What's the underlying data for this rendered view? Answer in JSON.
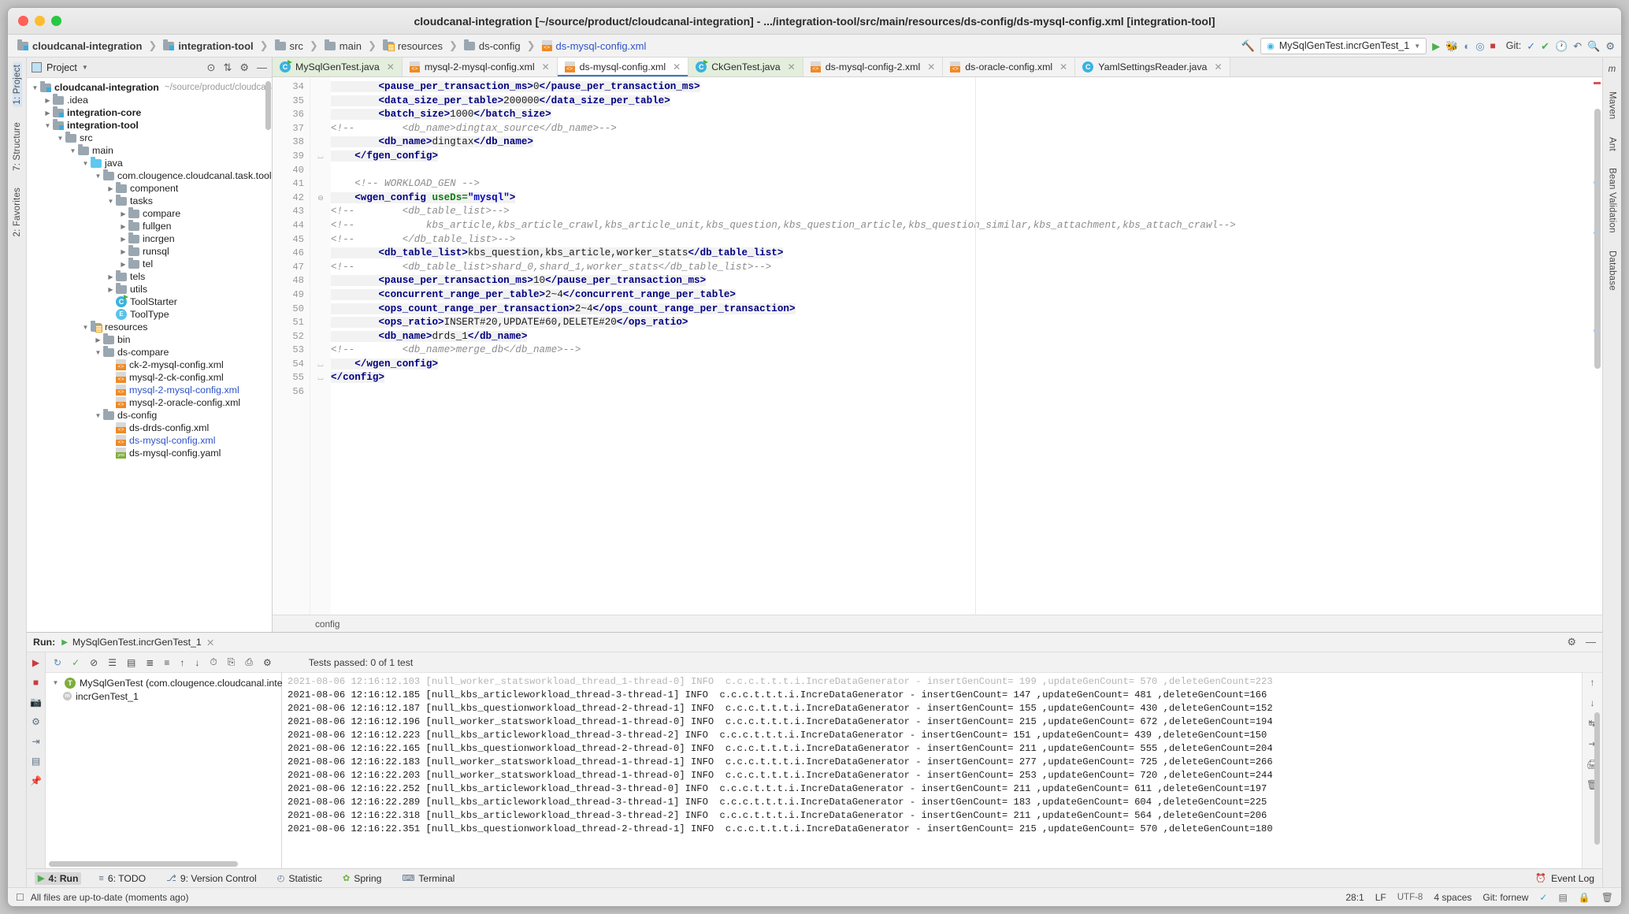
{
  "window": {
    "title": "cloudcanal-integration [~/source/product/cloudcanal-integration] - .../integration-tool/src/main/resources/ds-config/ds-mysql-config.xml [integration-tool]"
  },
  "breadcrumbs": [
    {
      "label": "cloudcanal-integration",
      "icon": "module-folder-icon",
      "style": "bold"
    },
    {
      "label": "integration-tool",
      "icon": "module-folder-icon",
      "style": "bold"
    },
    {
      "label": "src",
      "icon": "folder-icon",
      "style": "normal"
    },
    {
      "label": "main",
      "icon": "folder-icon",
      "style": "normal"
    },
    {
      "label": "resources",
      "icon": "resources-folder-icon",
      "style": "normal"
    },
    {
      "label": "ds-config",
      "icon": "folder-icon",
      "style": "normal"
    },
    {
      "label": "ds-mysql-config.xml",
      "icon": "xml-file-icon",
      "style": "link"
    }
  ],
  "toolbar": {
    "run_configuration": "MySqlGenTest.incrGenTest_1",
    "git_label": "Git:",
    "icons": [
      "hammer-icon",
      "run-icon",
      "debug-icon",
      "coverage-icon",
      "profile-icon",
      "stop-icon",
      "git-update-icon",
      "git-commit-icon",
      "history-icon",
      "undo-icon",
      "search-everywhere-icon",
      "settings-icon"
    ]
  },
  "project_panel": {
    "title": "Project",
    "header_icons": [
      "collapse-icon",
      "expand-icon",
      "settings-icon",
      "hide-icon"
    ],
    "tree": [
      {
        "depth": 0,
        "label": "cloudcanal-integration",
        "hint": "~/source/product/cloudcana",
        "arrow": "open",
        "icon": "module-folder-icon",
        "bold": true
      },
      {
        "depth": 1,
        "label": ".idea",
        "hint": "",
        "arrow": "closed",
        "icon": "folder-icon",
        "bold": false
      },
      {
        "depth": 1,
        "label": "integration-core",
        "hint": "",
        "arrow": "closed",
        "icon": "module-folder-icon",
        "bold": true
      },
      {
        "depth": 1,
        "label": "integration-tool",
        "hint": "",
        "arrow": "open",
        "icon": "module-folder-icon",
        "bold": true
      },
      {
        "depth": 2,
        "label": "src",
        "hint": "",
        "arrow": "open",
        "icon": "folder-icon",
        "bold": false
      },
      {
        "depth": 3,
        "label": "main",
        "hint": "",
        "arrow": "open",
        "icon": "folder-icon",
        "bold": false
      },
      {
        "depth": 4,
        "label": "java",
        "hint": "",
        "arrow": "open",
        "icon": "source-folder-icon",
        "bold": false
      },
      {
        "depth": 5,
        "label": "com.clougence.cloudcanal.task.tools",
        "hint": "",
        "arrow": "open",
        "icon": "package-icon",
        "bold": false
      },
      {
        "depth": 6,
        "label": "component",
        "hint": "",
        "arrow": "closed",
        "icon": "package-icon",
        "bold": false
      },
      {
        "depth": 6,
        "label": "tasks",
        "hint": "",
        "arrow": "open",
        "icon": "package-icon",
        "bold": false
      },
      {
        "depth": 7,
        "label": "compare",
        "hint": "",
        "arrow": "closed",
        "icon": "package-icon",
        "bold": false
      },
      {
        "depth": 7,
        "label": "fullgen",
        "hint": "",
        "arrow": "closed",
        "icon": "package-icon",
        "bold": false
      },
      {
        "depth": 7,
        "label": "incrgen",
        "hint": "",
        "arrow": "closed",
        "icon": "package-icon",
        "bold": false
      },
      {
        "depth": 7,
        "label": "runsql",
        "hint": "",
        "arrow": "closed",
        "icon": "package-icon",
        "bold": false
      },
      {
        "depth": 7,
        "label": "tel",
        "hint": "",
        "arrow": "closed",
        "icon": "package-icon",
        "bold": false
      },
      {
        "depth": 6,
        "label": "tels",
        "hint": "",
        "arrow": "closed",
        "icon": "package-icon",
        "bold": false
      },
      {
        "depth": 6,
        "label": "utils",
        "hint": "",
        "arrow": "closed",
        "icon": "package-icon",
        "bold": false
      },
      {
        "depth": 6,
        "label": "ToolStarter",
        "hint": "",
        "arrow": "none",
        "icon": "java-runnable-class-icon",
        "bold": false
      },
      {
        "depth": 6,
        "label": "ToolType",
        "hint": "",
        "arrow": "none",
        "icon": "java-enum-icon",
        "bold": false
      },
      {
        "depth": 4,
        "label": "resources",
        "hint": "",
        "arrow": "open",
        "icon": "resources-folder-icon",
        "bold": false
      },
      {
        "depth": 5,
        "label": "bin",
        "hint": "",
        "arrow": "closed",
        "icon": "folder-icon",
        "bold": false
      },
      {
        "depth": 5,
        "label": "ds-compare",
        "hint": "",
        "arrow": "open",
        "icon": "folder-icon",
        "bold": false
      },
      {
        "depth": 6,
        "label": "ck-2-mysql-config.xml",
        "hint": "",
        "arrow": "none",
        "icon": "xml-file-icon",
        "bold": false
      },
      {
        "depth": 6,
        "label": "mysql-2-ck-config.xml",
        "hint": "",
        "arrow": "none",
        "icon": "xml-file-icon",
        "bold": false
      },
      {
        "depth": 6,
        "label": "mysql-2-mysql-config.xml",
        "hint": "",
        "arrow": "none",
        "icon": "xml-file-icon",
        "bold": false,
        "link": true
      },
      {
        "depth": 6,
        "label": "mysql-2-oracle-config.xml",
        "hint": "",
        "arrow": "none",
        "icon": "xml-file-icon",
        "bold": false
      },
      {
        "depth": 5,
        "label": "ds-config",
        "hint": "",
        "arrow": "open",
        "icon": "folder-icon",
        "bold": false
      },
      {
        "depth": 6,
        "label": "ds-drds-config.xml",
        "hint": "",
        "arrow": "none",
        "icon": "xml-file-icon",
        "bold": false
      },
      {
        "depth": 6,
        "label": "ds-mysql-config.xml",
        "hint": "",
        "arrow": "none",
        "icon": "xml-file-icon",
        "bold": false,
        "link": true
      },
      {
        "depth": 6,
        "label": "ds-mysql-config.yaml",
        "hint": "",
        "arrow": "none",
        "icon": "yaml-file-icon",
        "bold": false
      }
    ]
  },
  "editor": {
    "tabs": [
      {
        "label": "MySqlGenTest.java",
        "icon": "java-runnable-class-icon",
        "state": "green"
      },
      {
        "label": "mysql-2-mysql-config.xml",
        "icon": "xml-file-icon",
        "state": "plain"
      },
      {
        "label": "ds-mysql-config.xml",
        "icon": "xml-file-icon",
        "state": "active"
      },
      {
        "label": "CkGenTest.java",
        "icon": "java-runnable-class-icon",
        "state": "green"
      },
      {
        "label": "ds-mysql-config-2.xml",
        "icon": "xml-file-icon",
        "state": "plain"
      },
      {
        "label": "ds-oracle-config.xml",
        "icon": "xml-file-icon",
        "state": "plain"
      },
      {
        "label": "YamlSettingsReader.java",
        "icon": "java-class-icon",
        "state": "plain"
      }
    ],
    "breadcrumb_status": "config",
    "first_line_number": 34,
    "lines": [
      {
        "n": 34,
        "fold": "",
        "segments": [
          {
            "t": "tag",
            "v": "        <pause_per_transaction_ms>"
          },
          {
            "t": "txt",
            "v": "0"
          },
          {
            "t": "tag",
            "v": "</pause_per_transaction_ms>"
          }
        ]
      },
      {
        "n": 35,
        "fold": "",
        "segments": [
          {
            "t": "tag",
            "v": "        <data_size_per_table>"
          },
          {
            "t": "txt",
            "v": "200000"
          },
          {
            "t": "tag",
            "v": "</data_size_per_table>"
          }
        ]
      },
      {
        "n": 36,
        "fold": "",
        "segments": [
          {
            "t": "tag",
            "v": "        <batch_size>"
          },
          {
            "t": "txt",
            "v": "1000"
          },
          {
            "t": "tag",
            "v": "</batch_size>"
          }
        ]
      },
      {
        "n": 37,
        "fold": "",
        "segments": [
          {
            "t": "cmt",
            "v": "<!--        <db_name>dingtax_source</db_name>-->"
          }
        ],
        "comment_offset": true
      },
      {
        "n": 38,
        "fold": "",
        "segments": [
          {
            "t": "tag",
            "v": "        <db_name>"
          },
          {
            "t": "txt",
            "v": "dingtax"
          },
          {
            "t": "tag",
            "v": "</db_name>"
          }
        ]
      },
      {
        "n": 39,
        "fold": "end",
        "segments": [
          {
            "t": "tag",
            "v": "    </fgen_config>"
          }
        ]
      },
      {
        "n": 40,
        "fold": "",
        "segments": []
      },
      {
        "n": 41,
        "fold": "",
        "segments": [
          {
            "t": "cmt",
            "v": "    <!-- WORKLOAD_GEN -->"
          }
        ]
      },
      {
        "n": 42,
        "fold": "start",
        "segments": [
          {
            "t": "tag",
            "v": "    <wgen_config "
          },
          {
            "t": "attr",
            "v": "useDs="
          },
          {
            "t": "aval",
            "v": "\"mysql\""
          },
          {
            "t": "tag",
            "v": ">"
          }
        ]
      },
      {
        "n": 43,
        "fold": "",
        "segments": [
          {
            "t": "cmt",
            "v": "<!--        <db_table_list>-->"
          }
        ],
        "comment_offset": true
      },
      {
        "n": 44,
        "fold": "",
        "segments": [
          {
            "t": "cmt",
            "v": "<!--            kbs_article,kbs_article_crawl,kbs_article_unit,kbs_question,kbs_question_article,kbs_question_similar,kbs_attachment,kbs_attach_crawl-->"
          }
        ],
        "comment_offset": true
      },
      {
        "n": 45,
        "fold": "",
        "segments": [
          {
            "t": "cmt",
            "v": "<!--        </db_table_list>-->"
          }
        ],
        "comment_offset": true
      },
      {
        "n": 46,
        "fold": "",
        "segments": [
          {
            "t": "tag",
            "v": "        <db_table_list>"
          },
          {
            "t": "txt",
            "v": "kbs_question,kbs_article,worker_stats"
          },
          {
            "t": "tag",
            "v": "</db_table_list>"
          }
        ]
      },
      {
        "n": 47,
        "fold": "",
        "segments": [
          {
            "t": "cmt",
            "v": "<!--        <db_table_list>shard_0,shard_1,worker_stats</db_table_list>-->"
          }
        ],
        "comment_offset": true
      },
      {
        "n": 48,
        "fold": "",
        "segments": [
          {
            "t": "tag",
            "v": "        <pause_per_transaction_ms>"
          },
          {
            "t": "txt",
            "v": "10"
          },
          {
            "t": "tag",
            "v": "</pause_per_transaction_ms>"
          }
        ]
      },
      {
        "n": 49,
        "fold": "",
        "segments": [
          {
            "t": "tag",
            "v": "        <concurrent_range_per_table>"
          },
          {
            "t": "txt",
            "v": "2~4"
          },
          {
            "t": "tag",
            "v": "</concurrent_range_per_table>"
          }
        ]
      },
      {
        "n": 50,
        "fold": "",
        "segments": [
          {
            "t": "tag",
            "v": "        <ops_count_range_per_transaction>"
          },
          {
            "t": "txt",
            "v": "2~4"
          },
          {
            "t": "tag",
            "v": "</ops_count_range_per_transaction>"
          }
        ]
      },
      {
        "n": 51,
        "fold": "",
        "segments": [
          {
            "t": "tag",
            "v": "        <ops_ratio>"
          },
          {
            "t": "txt",
            "v": "INSERT#20,UPDATE#60,DELETE#20"
          },
          {
            "t": "tag",
            "v": "</ops_ratio>"
          }
        ]
      },
      {
        "n": 52,
        "fold": "",
        "segments": [
          {
            "t": "tag",
            "v": "        <db_name>"
          },
          {
            "t": "txt",
            "v": "drds_1"
          },
          {
            "t": "tag",
            "v": "</db_name>"
          }
        ]
      },
      {
        "n": 53,
        "fold": "",
        "segments": [
          {
            "t": "cmt",
            "v": "<!--        <db_name>merge_db</db_name>-->"
          }
        ],
        "comment_offset": true
      },
      {
        "n": 54,
        "fold": "end",
        "segments": [
          {
            "t": "tag",
            "v": "    </wgen_config>"
          }
        ]
      },
      {
        "n": 55,
        "fold": "end",
        "segments": [
          {
            "t": "tag",
            "v": "</config>"
          }
        ]
      },
      {
        "n": 56,
        "fold": "",
        "segments": []
      }
    ]
  },
  "run_panel": {
    "title": "Run:",
    "config_name": "MySqlGenTest.incrGenTest_1",
    "tests_status": "Tests passed: 0 of 1 test",
    "test_tree": [
      {
        "depth": 0,
        "label": "MySqlGenTest (com.clougence.cloudcanal.integratio",
        "icon": "test-suite-icon"
      },
      {
        "depth": 1,
        "label": "incrGenTest_1",
        "icon": "test-method-icon"
      }
    ],
    "toolbar_icons": [
      "rerun-icon",
      "toggle-auto-test-icon",
      "mute-icon",
      "stacktrace-icon",
      "expand-all-icon",
      "collapse-all-icon",
      "prev-icon",
      "next-icon",
      "sort-icon",
      "export-icon",
      "open-icon",
      "settings-icon"
    ],
    "side_icons": [
      "rerun-icon",
      "stop-icon",
      "camera-icon",
      "thread-icon",
      "exit-icon",
      "layout-icon",
      "pin-icon"
    ],
    "console_side_icons": [
      "scroll-up-icon",
      "scroll-down-icon",
      "soft-wrap-icon",
      "scroll-end-icon",
      "print-icon",
      "trash-icon"
    ],
    "console_lines": [
      {
        "faint": true,
        "text": "2021-08-06 12:16:12.103 [null_worker_statsworkload_thread_1-thread-0] INFO  c.c.c.t.t.t.i.IncreDataGenerator - insertGenCount= 199 ,updateGenCount= 570 ,deleteGenCount=223"
      },
      {
        "faint": false,
        "text": "2021-08-06 12:16:12.185 [null_kbs_articleworkload_thread-3-thread-1] INFO  c.c.c.t.t.t.i.IncreDataGenerator - insertGenCount= 147 ,updateGenCount= 481 ,deleteGenCount=166"
      },
      {
        "faint": false,
        "text": "2021-08-06 12:16:12.187 [null_kbs_questionworkload_thread-2-thread-1] INFO  c.c.c.t.t.t.i.IncreDataGenerator - insertGenCount= 155 ,updateGenCount= 430 ,deleteGenCount=152"
      },
      {
        "faint": false,
        "text": "2021-08-06 12:16:12.196 [null_worker_statsworkload_thread-1-thread-0] INFO  c.c.c.t.t.t.i.IncreDataGenerator - insertGenCount= 215 ,updateGenCount= 672 ,deleteGenCount=194"
      },
      {
        "faint": false,
        "text": "2021-08-06 12:16:12.223 [null_kbs_articleworkload_thread-3-thread-2] INFO  c.c.c.t.t.t.i.IncreDataGenerator - insertGenCount= 151 ,updateGenCount= 439 ,deleteGenCount=150"
      },
      {
        "faint": false,
        "text": "2021-08-06 12:16:22.165 [null_kbs_questionworkload_thread-2-thread-0] INFO  c.c.c.t.t.t.i.IncreDataGenerator - insertGenCount= 211 ,updateGenCount= 555 ,deleteGenCount=204"
      },
      {
        "faint": false,
        "text": "2021-08-06 12:16:22.183 [null_worker_statsworkload_thread-1-thread-1] INFO  c.c.c.t.t.t.i.IncreDataGenerator - insertGenCount= 277 ,updateGenCount= 725 ,deleteGenCount=266"
      },
      {
        "faint": false,
        "text": "2021-08-06 12:16:22.203 [null_worker_statsworkload_thread-1-thread-0] INFO  c.c.c.t.t.t.i.IncreDataGenerator - insertGenCount= 253 ,updateGenCount= 720 ,deleteGenCount=244"
      },
      {
        "faint": false,
        "text": "2021-08-06 12:16:22.252 [null_kbs_articleworkload_thread-3-thread-0] INFO  c.c.c.t.t.t.i.IncreDataGenerator - insertGenCount= 211 ,updateGenCount= 611 ,deleteGenCount=197"
      },
      {
        "faint": false,
        "text": "2021-08-06 12:16:22.289 [null_kbs_articleworkload_thread-3-thread-1] INFO  c.c.c.t.t.t.i.IncreDataGenerator - insertGenCount= 183 ,updateGenCount= 604 ,deleteGenCount=225"
      },
      {
        "faint": false,
        "text": "2021-08-06 12:16:22.318 [null_kbs_articleworkload_thread-3-thread-2] INFO  c.c.c.t.t.t.i.IncreDataGenerator - insertGenCount= 211 ,updateGenCount= 564 ,deleteGenCount=206"
      },
      {
        "faint": false,
        "text": "2021-08-06 12:16:22.351 [null_kbs_questionworkload_thread-2-thread-1] INFO  c.c.c.t.t.t.i.IncreDataGenerator - insertGenCount= 215 ,updateGenCount= 570 ,deleteGenCount=180"
      }
    ]
  },
  "left_strip": [
    {
      "label": "1: Project",
      "selected": true
    },
    {
      "label": "7: Structure",
      "selected": false
    },
    {
      "label": "2: Favorites",
      "selected": false
    }
  ],
  "right_strip": [
    {
      "label": "m",
      "selected": false
    },
    {
      "label": "Maven",
      "selected": false
    },
    {
      "label": "Ant",
      "selected": false
    },
    {
      "label": "Bean Validation",
      "selected": false
    },
    {
      "label": "Database",
      "selected": false
    }
  ],
  "bottom_tabs": [
    {
      "label": "4: Run",
      "icon": "run-icon",
      "selected": true
    },
    {
      "label": "6: TODO",
      "icon": "todo-icon",
      "selected": false
    },
    {
      "label": "9: Version Control",
      "icon": "vcs-icon",
      "selected": false
    },
    {
      "label": "Statistic",
      "icon": "statistic-icon",
      "selected": false
    },
    {
      "label": "Spring",
      "icon": "spring-icon",
      "selected": false
    },
    {
      "label": "Terminal",
      "icon": "terminal-icon",
      "selected": false
    }
  ],
  "bottom_right": {
    "event_log": "Event Log"
  },
  "status_bar": {
    "message": "All files are up-to-date (moments ago)",
    "caret": "28:1",
    "line_sep": "LF",
    "encoding": "UTF-8",
    "indent": "4 spaces",
    "git_branch": "Git: fornew"
  },
  "colors": {
    "accent_blue": "#2f54c8",
    "tab_active_underline": "#3c77d3",
    "xml_tag": "#000080",
    "xml_attr_name": "#0b7d0b",
    "xml_attr_value": "#0000c0",
    "comment_gray": "#8c8c8c",
    "error_red": "#e05252",
    "tab_green": "#e3eedc"
  }
}
